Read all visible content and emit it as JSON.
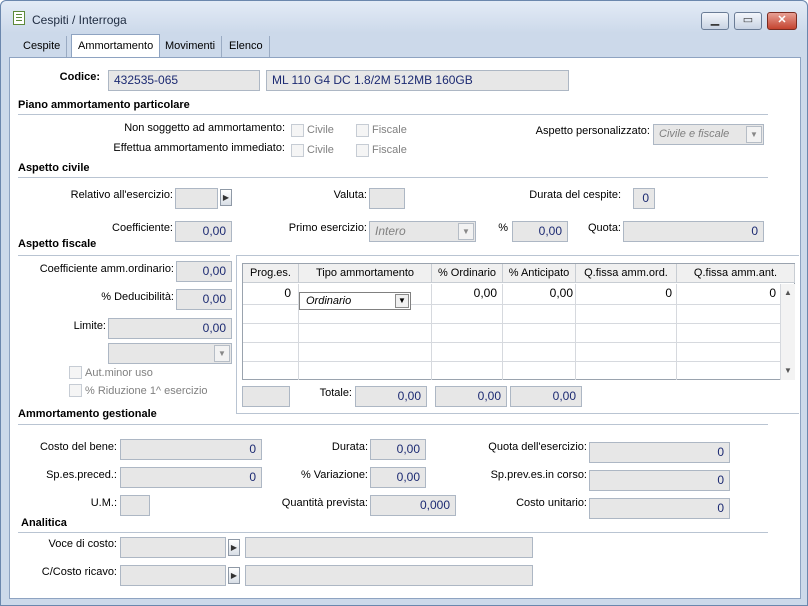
{
  "window": {
    "title": "Cespiti / Interroga"
  },
  "tabs": [
    "Cespite",
    "Ammortamento",
    "Movimenti",
    "Elenco"
  ],
  "codice": {
    "label": "Codice:",
    "value": "432535-065",
    "description": "ML 110 G4 DC 1.8/2M 512MB 160GB"
  },
  "piano": {
    "section": "Piano ammortamento particolare",
    "non_soggetto_label": "Non soggetto ad ammortamento:",
    "effettua_label": "Effettua ammortamento immediato:",
    "civile": "Civile",
    "fiscale": "Fiscale",
    "aspetto_pers_label": "Aspetto personalizzato:",
    "aspetto_pers_value": "Civile e fiscale"
  },
  "civile": {
    "section": "Aspetto civile",
    "relativo_label": "Relativo all'esercizio:",
    "valuta_label": "Valuta:",
    "durata_label": "Durata del cespite:",
    "durata_value": "0",
    "coeff_label": "Coefficiente:",
    "coeff_value": "0,00",
    "primo_label": "Primo esercizio:",
    "primo_value": "Intero",
    "perc_label": "%",
    "perc_value": "0,00",
    "quota_label": "Quota:",
    "quota_value": "0"
  },
  "fiscale": {
    "section": "Aspetto fiscale",
    "coeff_ord_label": "Coefficiente amm.ordinario:",
    "coeff_ord_value": "0,00",
    "deduc_label": "% Deducibilità:",
    "deduc_value": "0,00",
    "limite_label": "Limite:",
    "limite_value": "0,00",
    "aut_minor": "Aut.minor uso",
    "riduzione": "% Riduzione 1^ esercizio",
    "grid": {
      "headers": [
        "Prog.es.",
        "Tipo ammortamento",
        "% Ordinario",
        "% Anticipato",
        "Q.fissa amm.ord.",
        "Q.fissa amm.ant."
      ],
      "rows": [
        [
          "0",
          "Ordinario",
          "0,00",
          "0,00",
          "0",
          "0"
        ]
      ]
    },
    "totale_label": "Totale:",
    "totale_values": [
      "0,00",
      "0,00",
      "0,00"
    ]
  },
  "gestionale": {
    "section": "Ammortamento gestionale",
    "costo_label": "Costo del bene:",
    "costo_value": "0",
    "durata_label": "Durata:",
    "durata_value": "0,00",
    "quota_label": "Quota dell'esercizio:",
    "quota_value": "0",
    "spes_label": "Sp.es.preced.:",
    "spes_value": "0",
    "variazione_label": "% Variazione:",
    "variazione_value": "0,00",
    "spprev_label": "Sp.prev.es.in corso:",
    "spprev_value": "0",
    "um_label": "U.M.:",
    "quantita_label": "Quantità prevista:",
    "quantita_value": "0,000",
    "costo_unit_label": "Costo unitario:",
    "costo_unit_value": "0"
  },
  "analitica": {
    "section": "Analitica",
    "voce_label": "Voce di costo:",
    "ccosto_label": "C/Costo ricavo:"
  }
}
